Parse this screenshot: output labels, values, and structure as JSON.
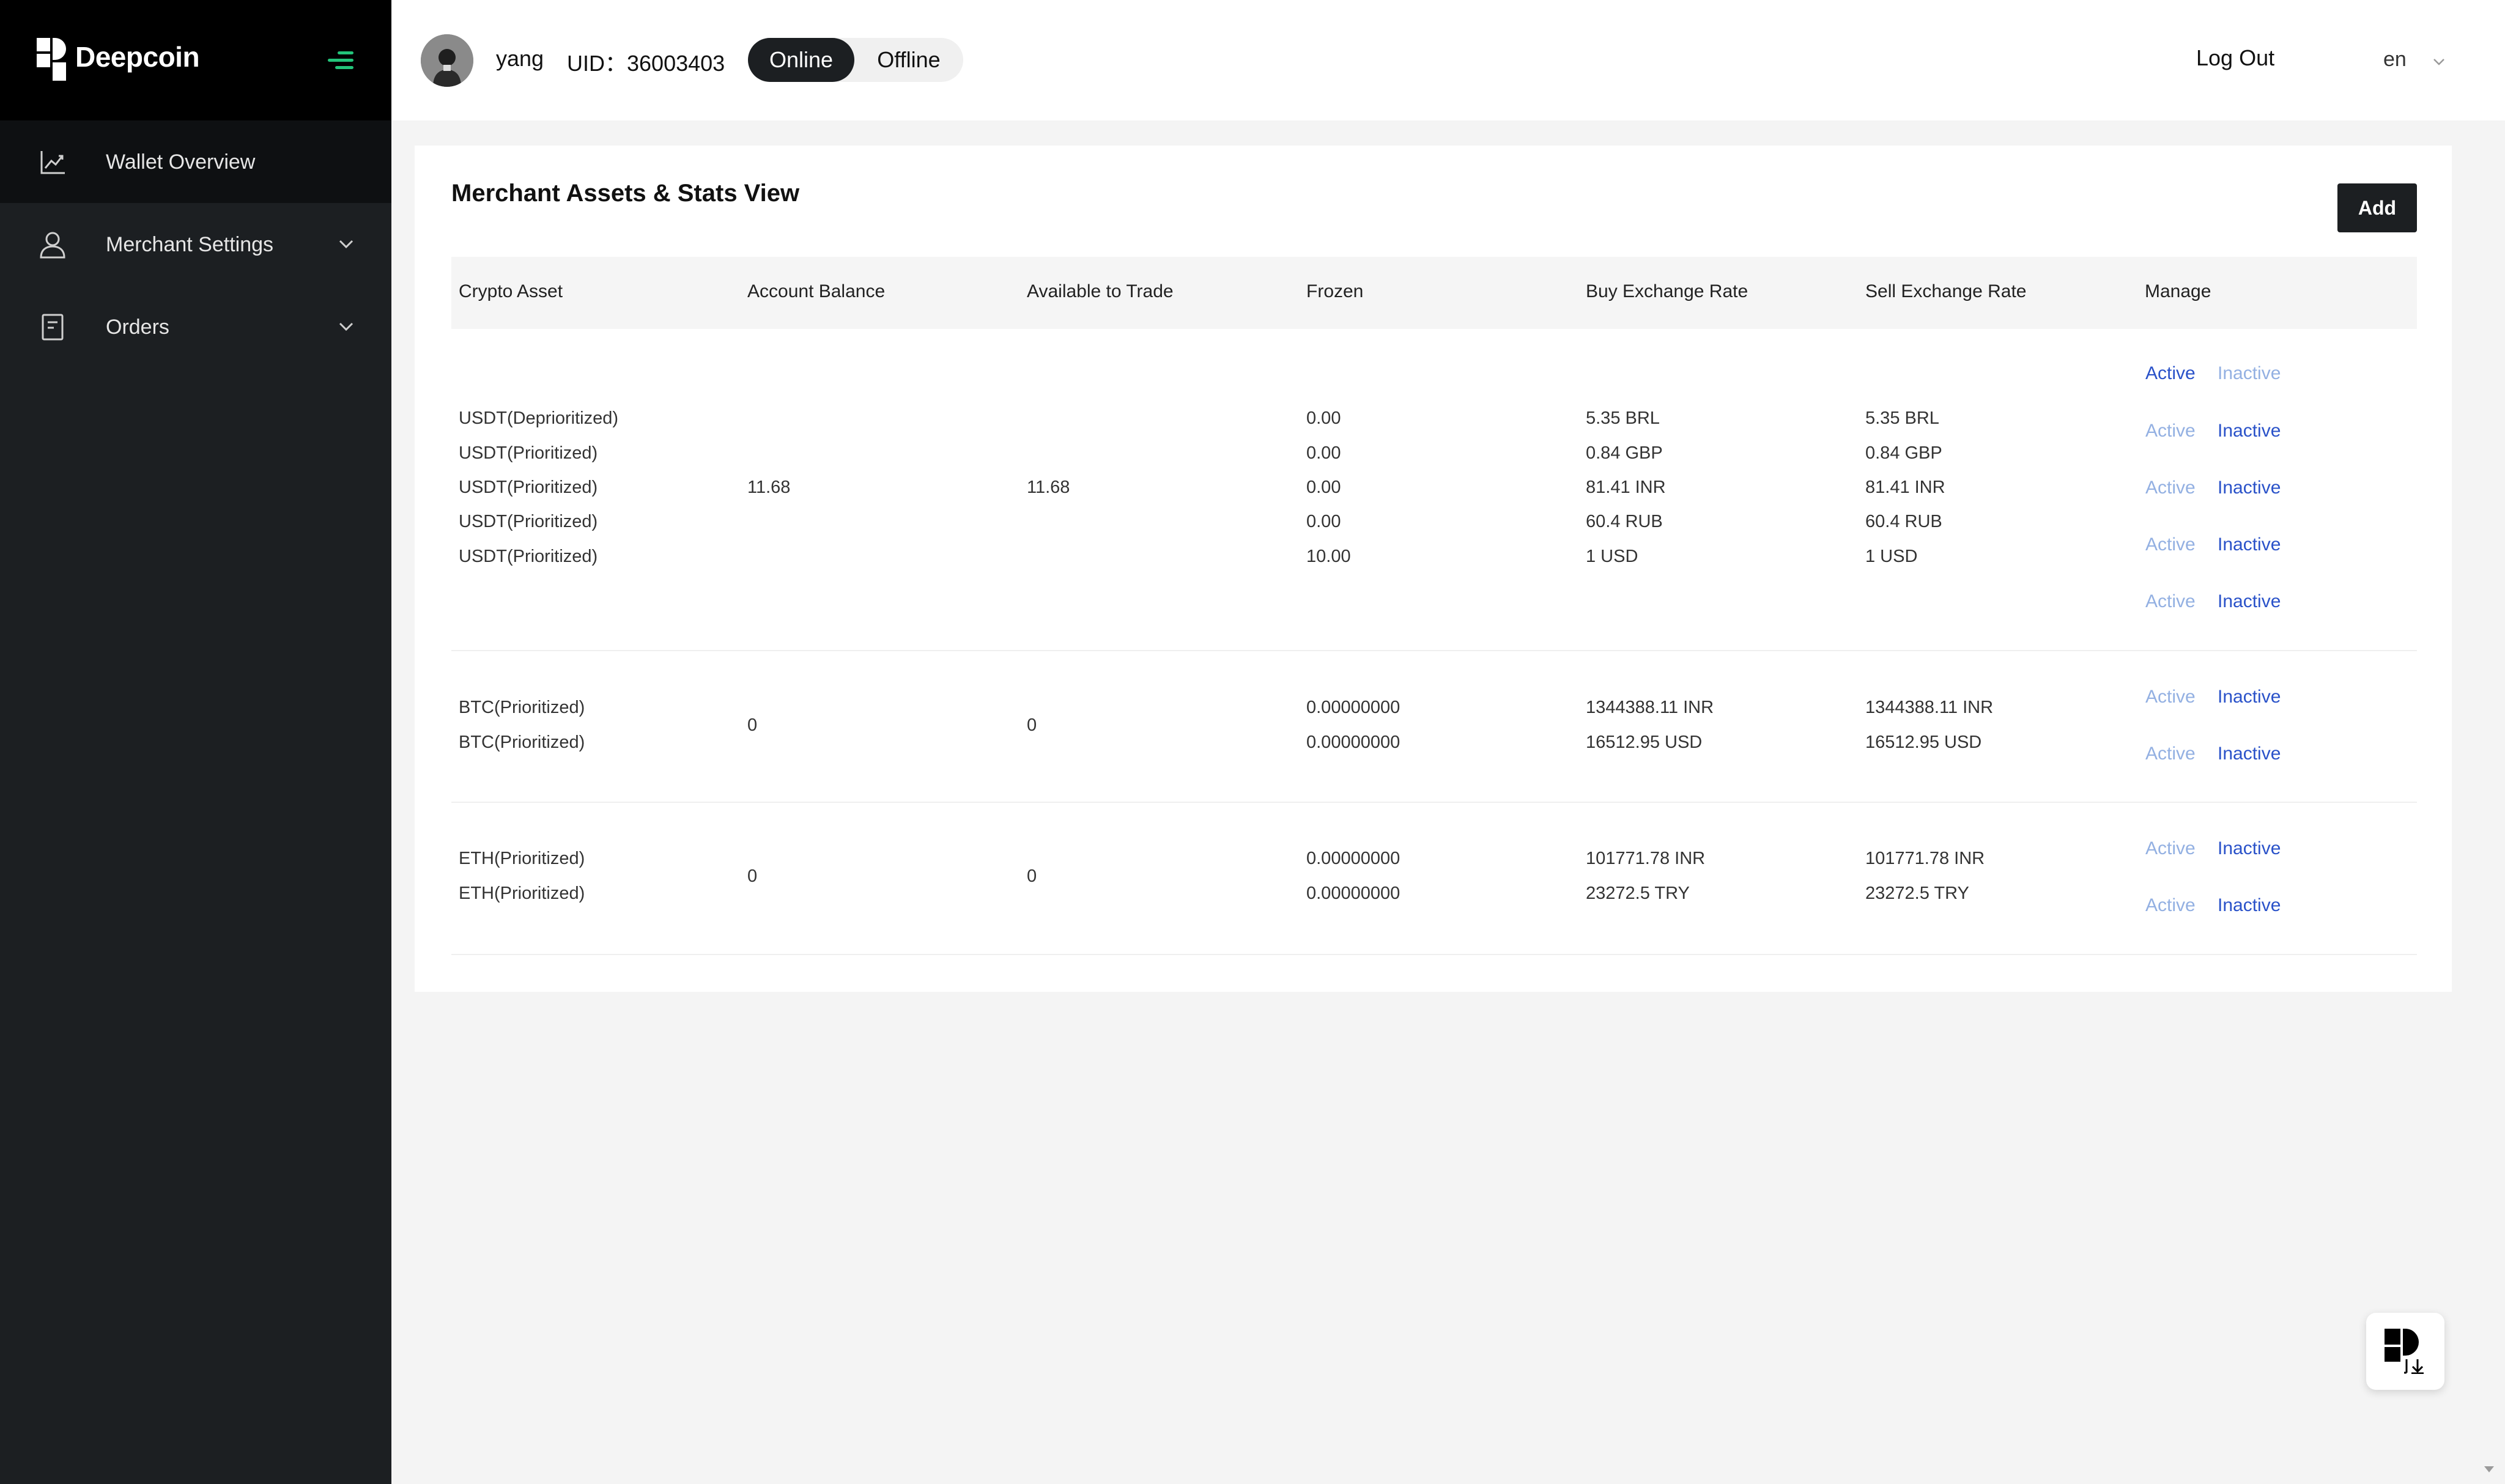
{
  "brand": {
    "name": "Deepcoin"
  },
  "sidebar": {
    "items": [
      {
        "label": "Wallet Overview",
        "icon": "chart-line-icon",
        "active": true
      },
      {
        "label": "Merchant Settings",
        "icon": "user-icon",
        "expandable": true
      },
      {
        "label": "Orders",
        "icon": "document-icon",
        "expandable": true
      }
    ]
  },
  "header": {
    "user_name": "yang",
    "uid": "UID：36003403",
    "status_online": "Online",
    "status_offline": "Offline",
    "status_selected": "Online",
    "logout": "Log Out",
    "language": "en"
  },
  "main": {
    "title": "Merchant Assets & Stats View",
    "add_label": "Add",
    "columns": [
      "Crypto Asset",
      "Account Balance",
      "Available to Trade",
      "Frozen",
      "Buy Exchange Rate",
      "Sell Exchange Rate",
      "Manage"
    ],
    "groups": [
      {
        "balance": "11.68",
        "available": "11.68",
        "rows": [
          {
            "asset": "USDT(Deprioritized)",
            "frozen": "0.00",
            "buy": "5.35 BRL",
            "sell": "5.35 BRL"
          },
          {
            "asset": "USDT(Prioritized)",
            "frozen": "0.00",
            "buy": "0.84 GBP",
            "sell": "0.84 GBP"
          },
          {
            "asset": "USDT(Prioritized)",
            "frozen": "0.00",
            "buy": "81.41 INR",
            "sell": "81.41 INR"
          },
          {
            "asset": "USDT(Prioritized)",
            "frozen": "0.00",
            "buy": "60.4 RUB",
            "sell": "60.4 RUB"
          },
          {
            "asset": "USDT(Prioritized)",
            "frozen": "10.00",
            "buy": "1 USD",
            "sell": "1 USD"
          }
        ],
        "manage": [
          {
            "active": "Active",
            "inactive": "Inactive",
            "state": "active"
          },
          {
            "active": "Active",
            "inactive": "Inactive",
            "state": "inactive"
          },
          {
            "active": "Active",
            "inactive": "Inactive",
            "state": "inactive"
          },
          {
            "active": "Active",
            "inactive": "Inactive",
            "state": "inactive"
          },
          {
            "active": "Active",
            "inactive": "Inactive",
            "state": "inactive"
          }
        ]
      },
      {
        "balance": "0",
        "available": "0",
        "rows": [
          {
            "asset": "BTC(Prioritized)",
            "frozen": "0.00000000",
            "buy": "1344388.11 INR",
            "sell": "1344388.11 INR"
          },
          {
            "asset": "BTC(Prioritized)",
            "frozen": "0.00000000",
            "buy": "16512.95 USD",
            "sell": "16512.95 USD"
          }
        ],
        "manage": [
          {
            "active": "Active",
            "inactive": "Inactive",
            "state": "inactive"
          },
          {
            "active": "Active",
            "inactive": "Inactive",
            "state": "inactive"
          }
        ]
      },
      {
        "balance": "0",
        "available": "0",
        "rows": [
          {
            "asset": "ETH(Prioritized)",
            "frozen": "0.00000000",
            "buy": "101771.78 INR",
            "sell": "101771.78 INR"
          },
          {
            "asset": "ETH(Prioritized)",
            "frozen": "0.00000000",
            "buy": "23272.5 TRY",
            "sell": "23272.5 TRY"
          }
        ],
        "manage": [
          {
            "active": "Active",
            "inactive": "Inactive",
            "state": "inactive"
          },
          {
            "active": "Active",
            "inactive": "Inactive",
            "state": "inactive"
          }
        ]
      }
    ]
  },
  "colors": {
    "sidebar_bg": "#1c1f22",
    "brand_bg": "#000000",
    "accent_green": "#23c47a",
    "link_blue": "#2a52c9",
    "link_faint": "#93b0e2"
  },
  "floating_button": {
    "icon": "deepcoin-app-download-icon"
  }
}
